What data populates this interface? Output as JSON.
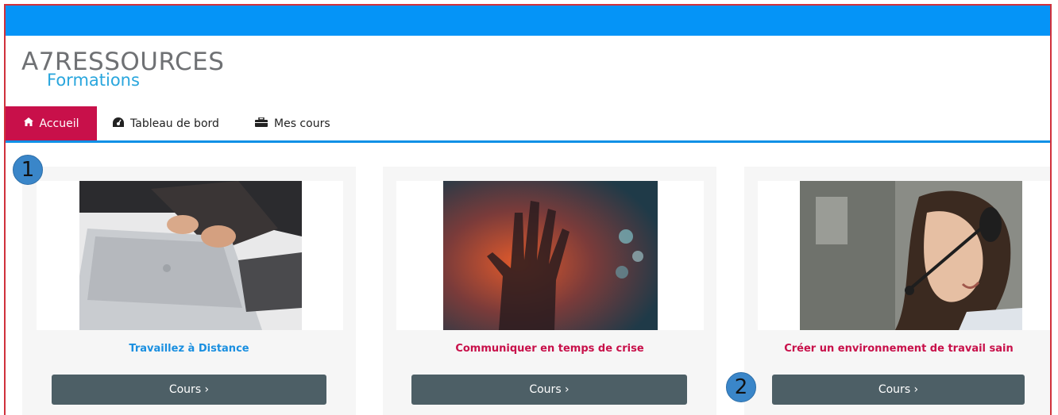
{
  "logo": {
    "main": "A7RESSOURCES",
    "sub": "Formations"
  },
  "nav": {
    "items": [
      {
        "label": "Accueil",
        "icon": "home-icon",
        "glyph": "🏠︎"
      },
      {
        "label": "Tableau de bord",
        "icon": "dashboard-icon",
        "glyph": "⏲"
      },
      {
        "label": "Mes cours",
        "icon": "briefcase-icon",
        "glyph": "▬"
      }
    ]
  },
  "courses": [
    {
      "title": "Travaillez à Distance",
      "title_color": "#1a8fe0",
      "button": "Cours ›"
    },
    {
      "title": "Communiquer en temps de crise",
      "title_color": "#c8104a",
      "button": "Cours ›"
    },
    {
      "title": "Créer un environnement de travail sain",
      "title_color": "#c8104a",
      "button": "Cours ›"
    }
  ],
  "badges": {
    "one": "1",
    "two": "2"
  },
  "colors": {
    "topbar": "#0594f7",
    "active_nav": "#c8104a",
    "button": "#4d5f66"
  }
}
